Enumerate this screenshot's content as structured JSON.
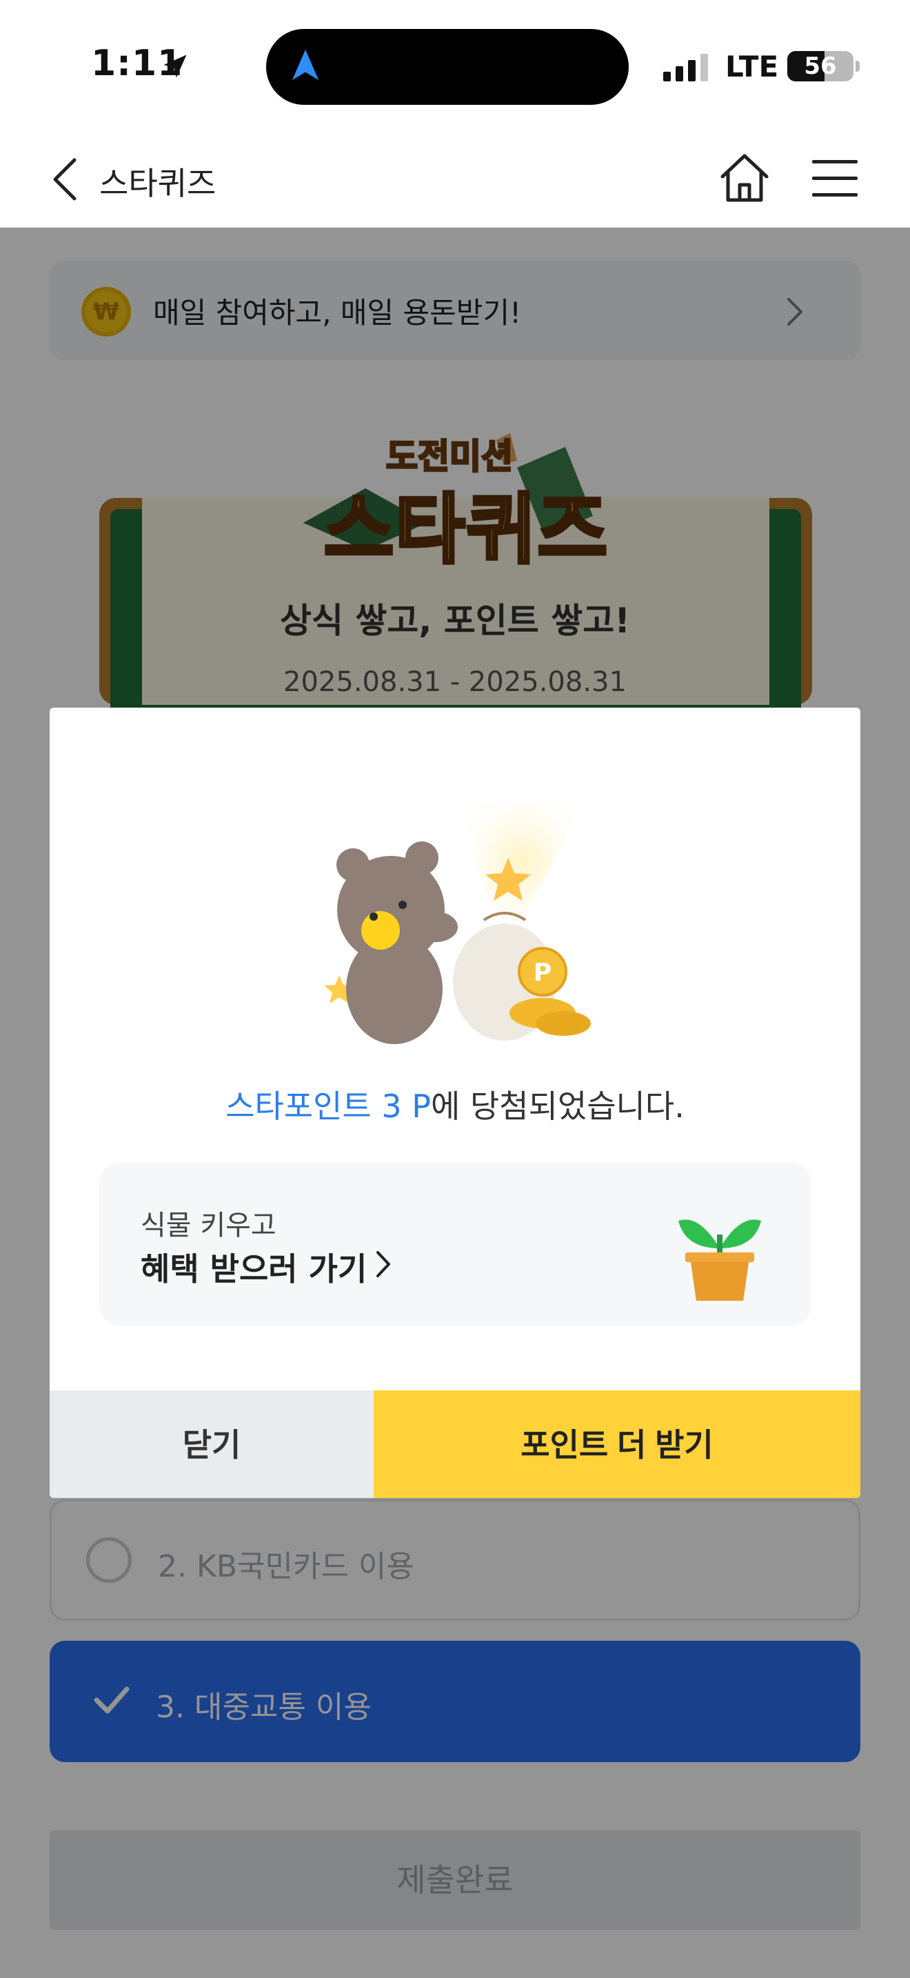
{
  "status_bar": {
    "time": "1:11",
    "network": "LTE",
    "battery_percent": "56",
    "battery_level": 0.56
  },
  "nav": {
    "title": "스타퀴즈"
  },
  "banner": {
    "coin_symbol": "₩",
    "text": "매일 참여하고, 매일 용돈받기!"
  },
  "quiz": {
    "logo_small": "도전미션",
    "logo_big": "스타퀴즈",
    "headline": "상식 쌓고, 포인트 쌓고!",
    "date_range": "2025.08.31 - 2025.08.31",
    "options": [
      {
        "label": "2. KB국민카드 이용",
        "selected": false
      },
      {
        "label": "3. 대중교통 이용",
        "selected": true
      }
    ],
    "submit_label": "제출완료"
  },
  "modal": {
    "result_highlight": "스타포인트 3 P",
    "result_rest": "에 당첨되었습니다.",
    "benefit_sub": "식물 키우고",
    "benefit_main": "혜택 받으러 가기",
    "close_label": "닫기",
    "more_label": "포인트 더 받기"
  },
  "colors": {
    "accent_blue": "#2b7de9",
    "selected_option": "#2a6ff0",
    "primary_button": "#ffd23a",
    "secondary_button": "#e9ecef"
  }
}
